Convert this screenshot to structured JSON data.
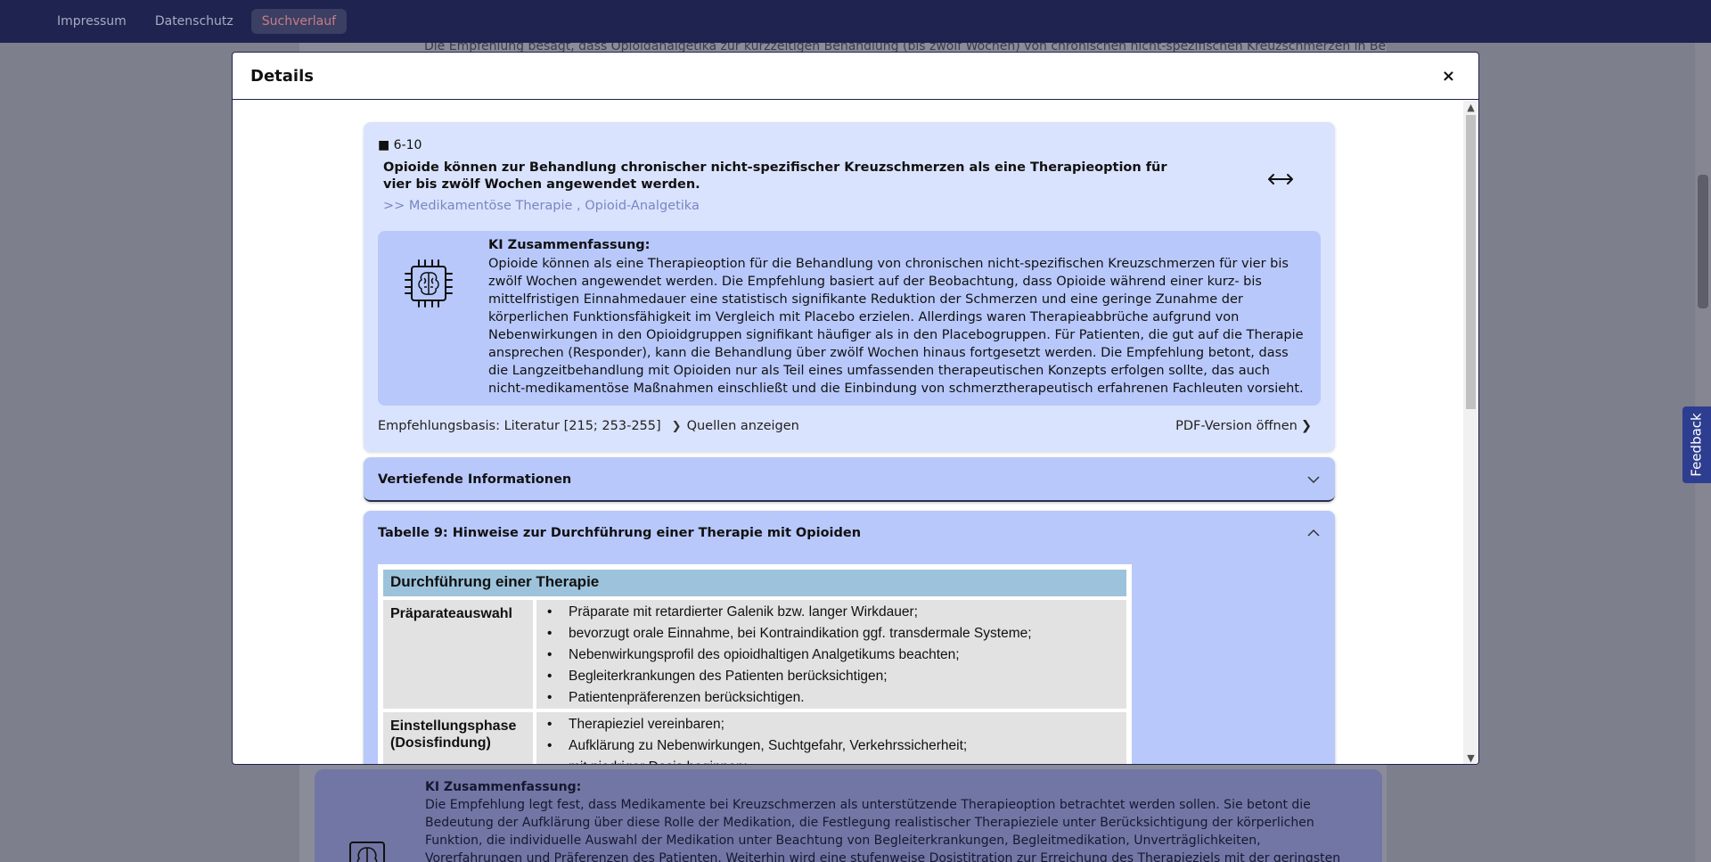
{
  "nav": {
    "links": [
      {
        "label": "Impressum"
      },
      {
        "label": "Datenschutz"
      },
      {
        "label": "Suchverlauf"
      }
    ]
  },
  "background": {
    "snippet": "Die Empfehlung besagt, dass Opioidanalgetika zur kurzzeitigen Behandlung (bis zwölf Wochen) von chronischen nicht-spezifischen Kreuzschmerzen in Betracht",
    "ai_title": "KI Zusammenfassung:",
    "ai_text": "Die Empfehlung legt fest, dass Medikamente bei Kreuzschmerzen als unterstützende Therapieoption betrachtet werden sollen. Sie betont die Bedeutung der Aufklärung über diese Rolle der Medikation, die Festlegung realistischer Therapieziele unter Berücksichtigung der körperlichen Funktion, die individuelle Auswahl der Medikation unter Beachtung von Begleiterkrankungen, Begleitmedikation, Unverträglichkeiten, Vorerfahrungen und Präferenzen des Patienten. Weiterhin wird eine stufenweise Dosistitration zur Erreichung des Therapieziels mit der geringsten effektiven Dosierung empfohlen. Die Überprüfung von"
  },
  "feedback": {
    "label": "Feedback"
  },
  "modal": {
    "title": "Details",
    "close": "×",
    "recommendation": {
      "number": "■ 6-10",
      "text": "Opioide können zur Behandlung chronischer nicht-spezifischer Kreuzschmerzen als eine Therapieoption für vier bis zwölf Wochen angewendet werden.",
      "category": ">> Medikamentöse Therapie , Opioid-Analgetika",
      "ai_title": "KI Zusammenfassung:",
      "ai_text": "Opioide können als eine Therapieoption für die Behandlung von chronischen nicht-spezifischen Kreuzschmerzen für vier bis zwölf Wochen angewendet werden. Die Empfehlung basiert auf der Beobachtung, dass Opioide während einer kurz- bis mittelfristigen Einnahmedauer eine statistisch signifikante Reduktion der Schmerzen und eine geringe Zunahme der körperlichen Funktionsfähigkeit im Vergleich mit Placebo erzielen. Allerdings waren Therapieabbrüche aufgrund von Nebenwirkungen in den Opioidgruppen signifikant häufiger als in den Placebogruppen. Für Patienten, die gut auf die Therapie ansprechen (Responder), kann die Behandlung über zwölf Wochen hinaus fortgesetzt werden. Die Empfehlung betont, dass die Langzeitbehandlung mit Opioiden nur als Teil eines umfassenden therapeutischen Konzepts erfolgen sollte, das auch nicht-medikamentöse Maßnahmen einschließt und die Einbindung von schmerztherapeutisch erfahrenen Fachleuten vorsieht.",
      "basis": "Empfehlungsbasis: Literatur [215; 253-255]",
      "sources_link": "Quellen anzeigen",
      "pdf_link": "PDF-Version öffnen"
    },
    "accordions": [
      {
        "title": "Vertiefende Informationen",
        "expanded": false
      },
      {
        "title": "Tabelle 9: Hinweise zur Durchführung einer Therapie mit Opioiden",
        "expanded": true
      }
    ],
    "table": {
      "header": "Durchführung einer Therapie",
      "rows": [
        {
          "label": "Präparateauswahl",
          "items": [
            "Präparate mit retardierter Galenik bzw. langer Wirkdauer;",
            "bevorzugt orale Einnahme, bei Kontraindikation ggf. transdermale Systeme;",
            "Nebenwirkungsprofil des opioidhaltigen Analgetikums beachten;",
            "Begleiterkrankungen des Patienten berücksichtigen;",
            "Patientenpräferenzen berücksichtigen."
          ]
        },
        {
          "label": "Einstellungsphase (Dosisfindung)",
          "items": [
            "Therapieziel vereinbaren;",
            "Aufklärung zu Nebenwirkungen, Suchtgefahr, Verkehrssicherheit;",
            "mit niedriger Dosis beginnen;"
          ]
        }
      ]
    }
  },
  "colors": {
    "topbar": "#1e2350",
    "card": "#dae3fd",
    "ai_box": "#b8c8fb",
    "table_header": "#9dc3dc",
    "category_link": "#7986c2"
  },
  "icons": {
    "brain": "brain-chip-icon",
    "expand": "horizontal-arrows-icon",
    "chevron_down": "chevron-down-icon",
    "chevron_up": "chevron-up-icon",
    "chevron_right": "chevron-right-icon"
  }
}
